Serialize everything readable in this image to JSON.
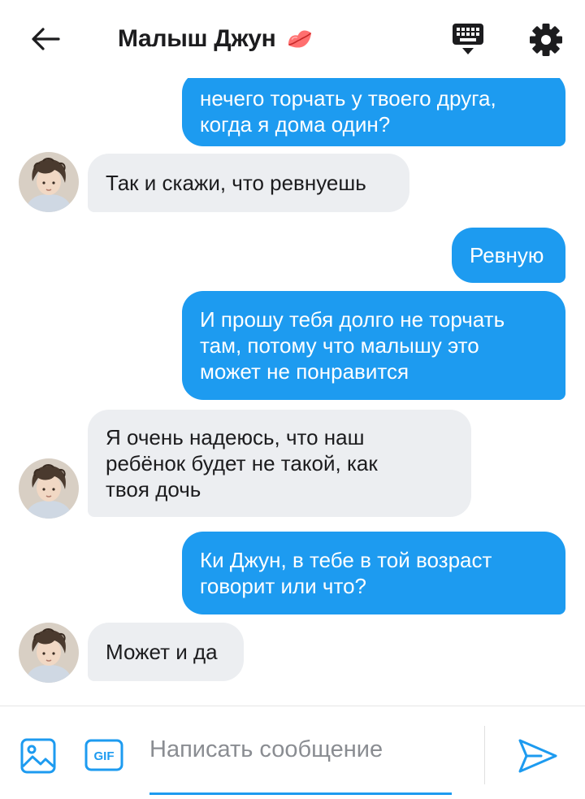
{
  "header": {
    "title": "Малыш Джун",
    "title_emoji": "💋",
    "back_icon": "arrow-left-icon",
    "keyboard_icon": "keyboard-icon",
    "settings_icon": "gear-icon"
  },
  "messages": [
    {
      "side": "out",
      "text": "нечего торчать у твоего друга,\nкогда я дома один?"
    },
    {
      "side": "in",
      "text": "Так и скажи, что ревнуешь"
    },
    {
      "side": "out",
      "text": "Ревную"
    },
    {
      "side": "out",
      "text": "И прошу тебя долго не торчать\nтам, потому что малышу это\nможет не понравится"
    },
    {
      "side": "in",
      "text": "Я очень надеюсь, что наш\nребёнок будет не такой, как\nтвоя дочь"
    },
    {
      "side": "out",
      "text": "Ки Джун, в тебе в той возраст\nговорит или что?"
    },
    {
      "side": "in",
      "text": "Может и да"
    }
  ],
  "composer": {
    "placeholder": "Написать сообщение",
    "image_icon": "image-icon",
    "gif_label": "GIF",
    "send_icon": "send-icon"
  },
  "colors": {
    "outgoing_bubble": "#1d9bf0",
    "incoming_bubble": "#eceef1",
    "accent": "#1d9bf0"
  }
}
